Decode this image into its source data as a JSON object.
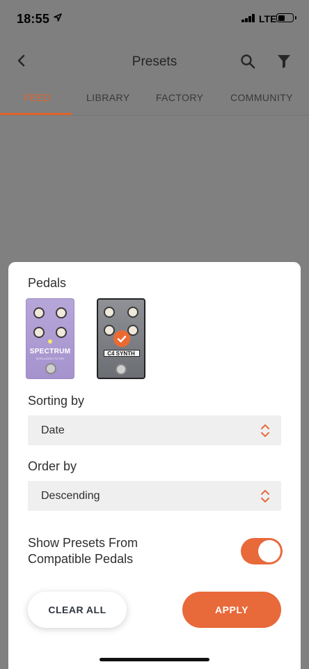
{
  "status_bar": {
    "time": "18:55",
    "network": "LTE",
    "battery_level": 0.4
  },
  "header": {
    "title": "Presets",
    "tabs": [
      {
        "label": "FEED",
        "active": true
      },
      {
        "label": "LIBRARY",
        "active": false
      },
      {
        "label": "FACTORY",
        "active": false
      },
      {
        "label": "COMMUNITY",
        "active": false
      }
    ]
  },
  "filter_sheet": {
    "pedals_label": "Pedals",
    "pedals": [
      {
        "name": "SPECTRUM",
        "subtitle": "INTELLIGENT FILTER",
        "selected": false
      },
      {
        "name": "C4 SYNTH",
        "selected": true
      }
    ],
    "sorting_label": "Sorting by",
    "sorting_value": "Date",
    "order_label": "Order by",
    "order_value": "Descending",
    "compatible_label_line1": "Show Presets From",
    "compatible_label_line2": "Compatible Pedals",
    "compatible_enabled": true,
    "clear_label": "CLEAR ALL",
    "apply_label": "APPLY"
  },
  "colors": {
    "accent": "#e8693a",
    "dim_background": "#7f7f7f",
    "sheet": "#ffffff"
  },
  "icons": [
    "location-arrow-icon",
    "back-chevron-icon",
    "search-icon",
    "filter-funnel-icon",
    "updown-chevrons-icon",
    "checkmark-icon"
  ]
}
